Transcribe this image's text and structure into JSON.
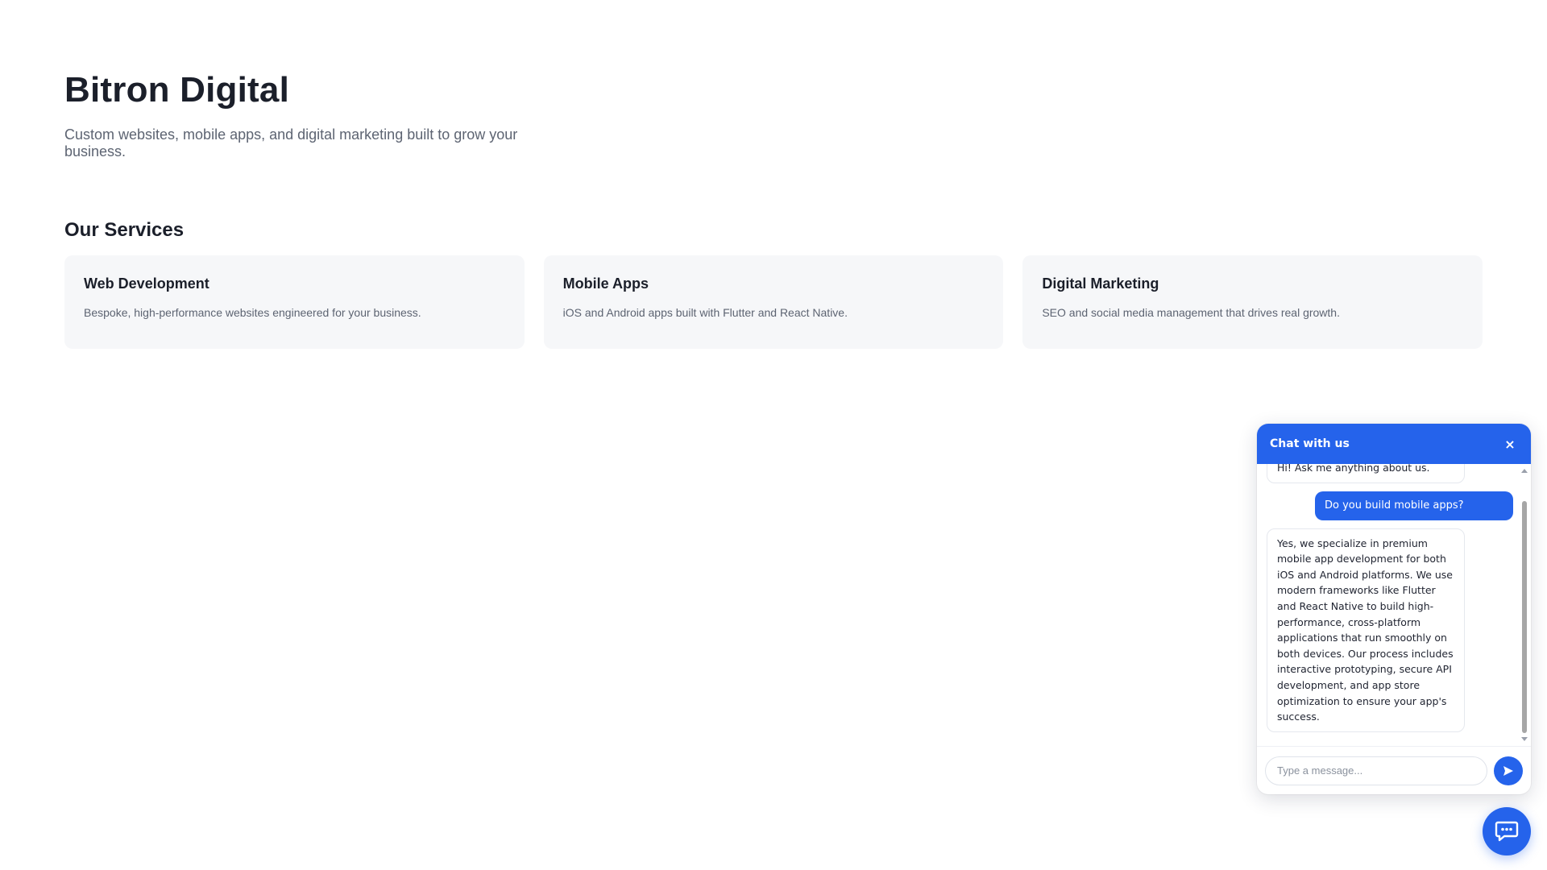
{
  "hero": {
    "title": "Bitron Digital",
    "subtitle": "Custom websites, mobile apps, and digital marketing built to grow your business."
  },
  "services": {
    "heading": "Our Services",
    "items": [
      {
        "title": "Web Development",
        "description": "Bespoke, high-performance websites engineered for your business."
      },
      {
        "title": "Mobile Apps",
        "description": "iOS and Android apps built with Flutter and React Native."
      },
      {
        "title": "Digital Marketing",
        "description": "SEO and social media management that drives real growth."
      }
    ]
  },
  "chat": {
    "title": "Chat with us",
    "close_label": "×",
    "messages": [
      {
        "role": "bot",
        "text": "Hi! Ask me anything about us."
      },
      {
        "role": "user",
        "text": "Do you build mobile apps?"
      },
      {
        "role": "bot",
        "text": "Yes, we specialize in premium mobile app development for both iOS and Android platforms. We use modern frameworks like Flutter and React Native to build high-performance, cross-platform applications that run smoothly on both devices. Our process includes interactive prototyping, secure API development, and app store optimization to ensure your app's success."
      }
    ],
    "input_placeholder": "Type a message...",
    "send_icon": "send-icon",
    "accent_color": "#2563eb"
  },
  "launcher": {
    "icon": "chat-bubble-icon"
  }
}
